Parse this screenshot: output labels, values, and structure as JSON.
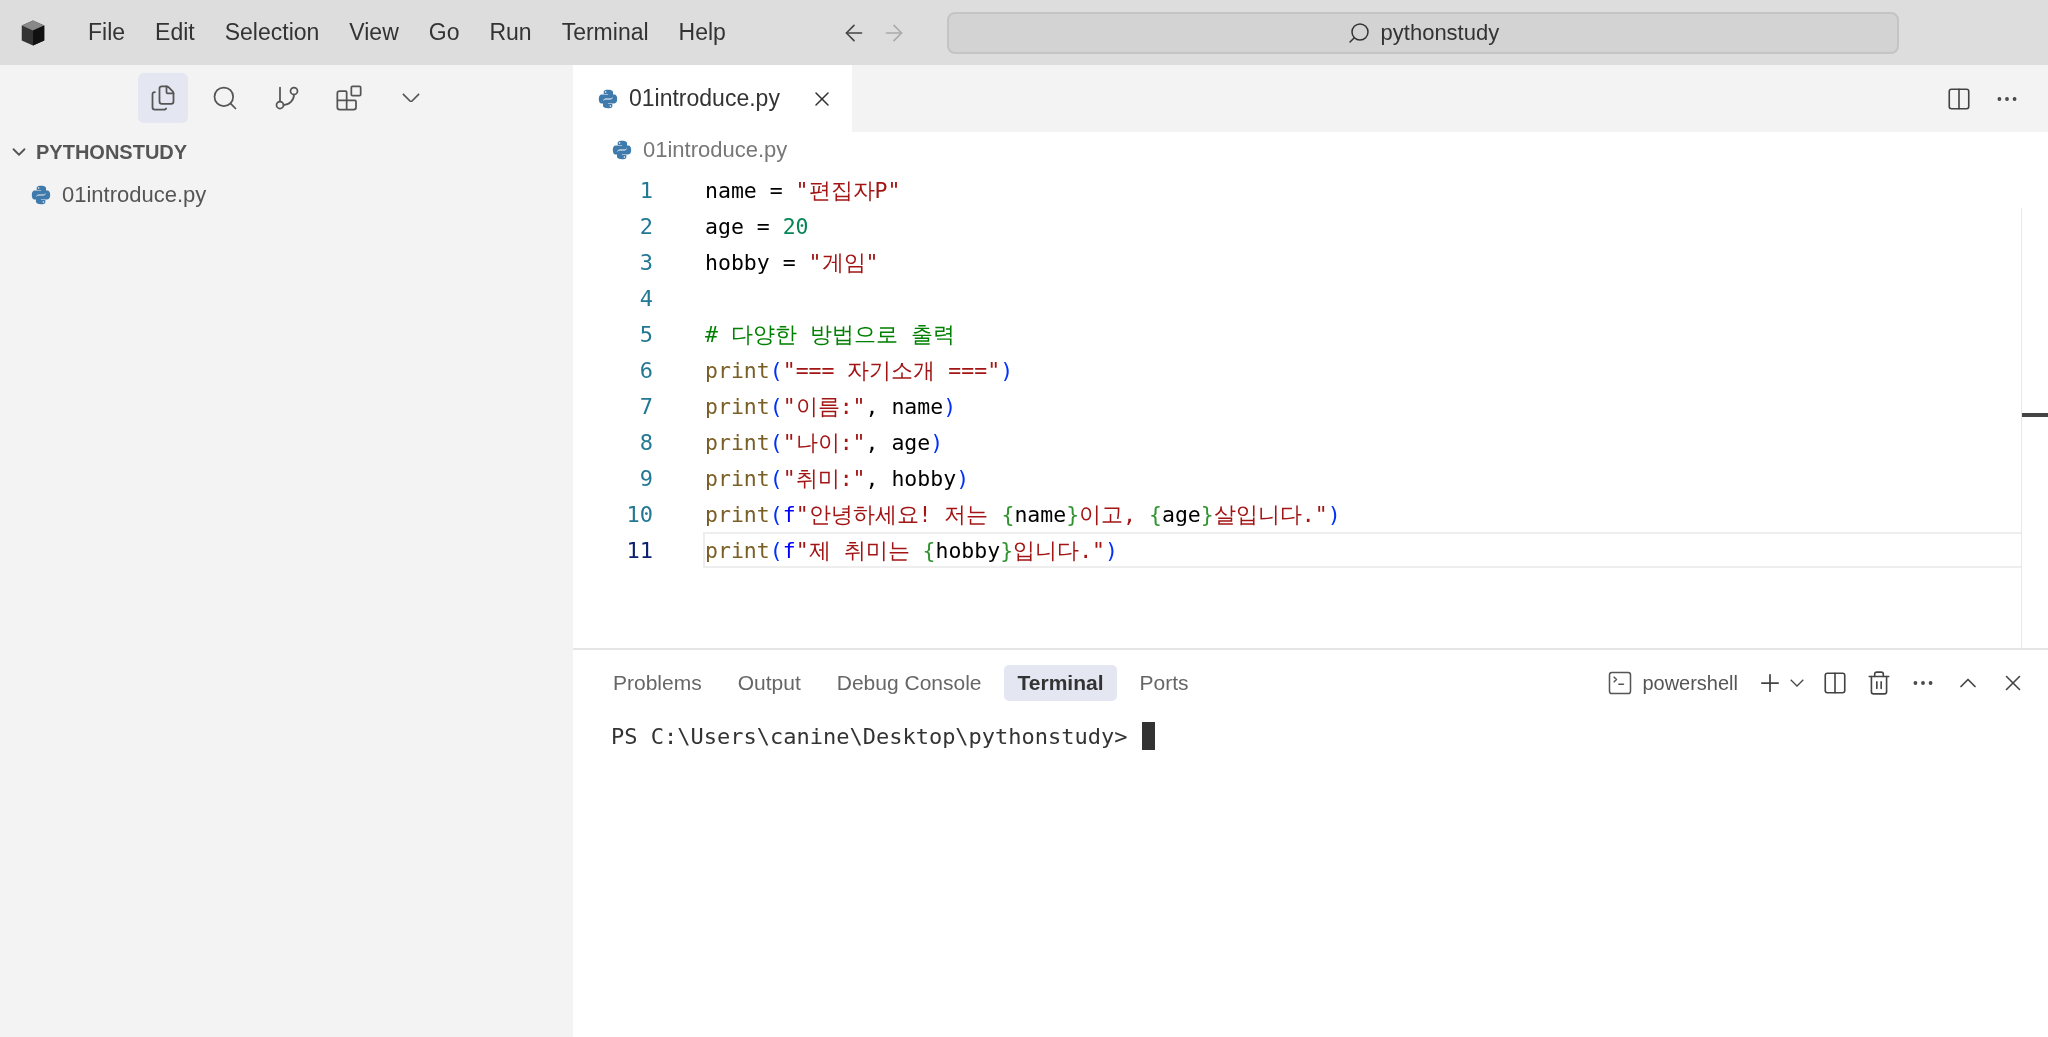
{
  "menu": [
    {
      "label": "File"
    },
    {
      "label": "Edit"
    },
    {
      "label": "Selection"
    },
    {
      "label": "View"
    },
    {
      "label": "Go"
    },
    {
      "label": "Run"
    },
    {
      "label": "Terminal"
    },
    {
      "label": "Help"
    }
  ],
  "command_center": {
    "text": "pythonstudy"
  },
  "activity_bar": [
    {
      "kind": "explorer",
      "selected": true
    },
    {
      "kind": "search",
      "selected": false
    },
    {
      "kind": "source-control",
      "selected": false
    },
    {
      "kind": "extensions",
      "selected": false
    },
    {
      "kind": "more",
      "selected": false
    }
  ],
  "explorer": {
    "folder": "PYTHONSTUDY",
    "expanded": true,
    "files": [
      {
        "name": "01introduce.py"
      }
    ]
  },
  "editor_tabs": [
    {
      "label": "01introduce.py",
      "selected": true
    }
  ],
  "breadcrumb": "01introduce.py",
  "code": [
    {
      "number": "1",
      "current": false,
      "tokens": [
        {
          "kind": "text",
          "text": "name = "
        },
        {
          "kind": "string",
          "text": "\"편집자P\""
        }
      ]
    },
    {
      "number": "2",
      "current": false,
      "tokens": [
        {
          "kind": "text",
          "text": "age = "
        },
        {
          "kind": "number",
          "text": "20"
        }
      ]
    },
    {
      "number": "3",
      "current": false,
      "tokens": [
        {
          "kind": "text",
          "text": "hobby = "
        },
        {
          "kind": "string",
          "text": "\"게임\""
        }
      ]
    },
    {
      "number": "4",
      "current": false
    },
    {
      "number": "5",
      "current": false,
      "tokens": [
        {
          "kind": "comment",
          "text": "# 다양한 방법으로 출력"
        }
      ]
    },
    {
      "number": "6",
      "current": false,
      "tokens": [
        {
          "kind": "function",
          "text": "print"
        },
        {
          "kind": "bracket",
          "text": "("
        },
        {
          "kind": "string",
          "text": "\"=== 자기소개 ===\""
        },
        {
          "kind": "bracket",
          "text": ")"
        }
      ]
    },
    {
      "number": "7",
      "current": false,
      "tokens": [
        {
          "kind": "function",
          "text": "print"
        },
        {
          "kind": "bracket",
          "text": "("
        },
        {
          "kind": "string",
          "text": "\"이름:\""
        },
        {
          "kind": "text",
          "text": ", name"
        },
        {
          "kind": "bracket",
          "text": ")"
        }
      ]
    },
    {
      "number": "8",
      "current": false,
      "tokens": [
        {
          "kind": "function",
          "text": "print"
        },
        {
          "kind": "bracket",
          "text": "("
        },
        {
          "kind": "string",
          "text": "\"나이:\""
        },
        {
          "kind": "text",
          "text": ", age"
        },
        {
          "kind": "bracket",
          "text": ")"
        }
      ]
    },
    {
      "number": "9",
      "current": false,
      "tokens": [
        {
          "kind": "function",
          "text": "print"
        },
        {
          "kind": "bracket",
          "text": "("
        },
        {
          "kind": "string",
          "text": "\"취미:\""
        },
        {
          "kind": "text",
          "text": ", hobby"
        },
        {
          "kind": "bracket",
          "text": ")"
        }
      ]
    },
    {
      "number": "10",
      "current": false,
      "tokens": [
        {
          "kind": "function",
          "text": "print"
        },
        {
          "kind": "bracket",
          "text": "("
        },
        {
          "kind": "prefix",
          "text": "f"
        },
        {
          "kind": "string",
          "text": "\"안녕하세요! 저는 "
        },
        {
          "kind": "brace",
          "text": "{"
        },
        {
          "kind": "text",
          "text": "name"
        },
        {
          "kind": "brace",
          "text": "}"
        },
        {
          "kind": "string",
          "text": "이고, "
        },
        {
          "kind": "brace",
          "text": "{"
        },
        {
          "kind": "text",
          "text": "age"
        },
        {
          "kind": "brace",
          "text": "}"
        },
        {
          "kind": "string",
          "text": "살입니다.\""
        },
        {
          "kind": "bracket",
          "text": ")"
        }
      ]
    },
    {
      "number": "11",
      "current": true,
      "tokens": [
        {
          "kind": "function",
          "text": "print"
        },
        {
          "kind": "bracket",
          "text": "("
        },
        {
          "kind": "prefix",
          "text": "f"
        },
        {
          "kind": "string",
          "text": "\"제 취미는 "
        },
        {
          "kind": "brace",
          "text": "{"
        },
        {
          "kind": "text",
          "text": "hobby"
        },
        {
          "kind": "brace",
          "text": "}"
        },
        {
          "kind": "string",
          "text": "입니다.\""
        },
        {
          "kind": "bracket",
          "text": ")"
        }
      ]
    }
  ],
  "panel_tabs": [
    {
      "label": "Problems",
      "selected": false
    },
    {
      "label": "Output",
      "selected": false
    },
    {
      "label": "Debug Console",
      "selected": false
    },
    {
      "label": "Terminal",
      "selected": true
    },
    {
      "label": "Ports",
      "selected": false
    }
  ],
  "terminal": {
    "profile": "powershell",
    "prompt": "PS C:\\Users\\canine\\Desktop\\pythonstudy>"
  }
}
